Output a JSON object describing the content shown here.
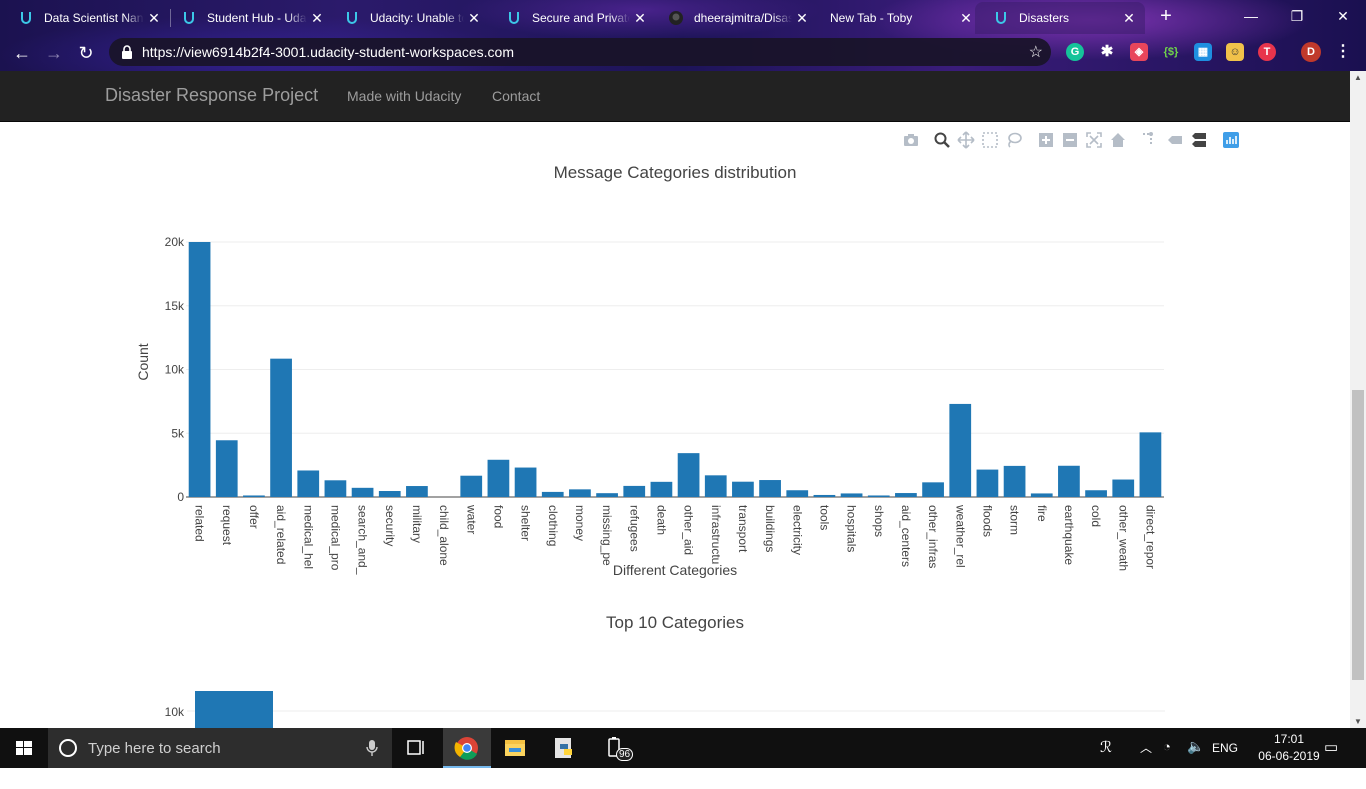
{
  "browser": {
    "tabs": [
      {
        "title": "Data Scientist Nanodegree",
        "icon": "udacity-icon"
      },
      {
        "title": "Student Hub - Udacity",
        "icon": "udacity-icon"
      },
      {
        "title": "Udacity: Unable to connect",
        "icon": "udacity-icon"
      },
      {
        "title": "Secure and Private",
        "icon": "udacity-icon"
      },
      {
        "title": "dheerajmitra/Disaster",
        "icon": "github-icon"
      },
      {
        "title": "New Tab - Toby",
        "icon": "none"
      },
      {
        "title": "Disasters",
        "icon": "udacity-icon"
      }
    ],
    "url": "https://view6914b2f4-3001.udacity-student-workspaces.com",
    "profile_initial": "D",
    "colors": {
      "accent": "#1f77b4",
      "navbar": "#222222"
    }
  },
  "navbar": {
    "brand": "Disaster Response Project",
    "links": [
      "Made with Udacity",
      "Contact"
    ]
  },
  "chart_data": [
    {
      "type": "bar",
      "title": "Message Categories distribution",
      "xlabel": "Different Categories",
      "ylabel": "Count",
      "ylim": [
        0,
        20000
      ],
      "yticks": [
        "0",
        "5k",
        "10k",
        "15k",
        "20k"
      ],
      "grid": true,
      "categories": [
        "related",
        "request",
        "offer",
        "aid_related",
        "medical_help",
        "medical_products",
        "search_and_rescue",
        "security",
        "military",
        "child_alone",
        "water",
        "food",
        "shelter",
        "clothing",
        "money",
        "missing_people",
        "refugees",
        "death",
        "other_aid",
        "infrastructure_related",
        "transport",
        "buildings",
        "electricity",
        "tools",
        "hospitals",
        "shops",
        "aid_centers",
        "other_infrastructure",
        "weather_related",
        "floods",
        "storm",
        "fire",
        "earthquake",
        "cold",
        "other_weather",
        "direct_report"
      ],
      "tick_labels": [
        "related",
        "request",
        "offer",
        "aid_related",
        "medical_hel",
        "medical_pro",
        "search_and_",
        "security",
        "military",
        "child_alone",
        "water",
        "food",
        "shelter",
        "clothing",
        "money",
        "missing_pe",
        "refugees",
        "death",
        "other_aid",
        "infrastructu",
        "transport",
        "buildings",
        "electricity",
        "tools",
        "hospitals",
        "shops",
        "aid_centers",
        "other_infras",
        "weather_rel",
        "floods",
        "storm",
        "fire",
        "earthquake",
        "cold",
        "other_weath",
        "direct_repor"
      ],
      "values": [
        20000,
        4450,
        120,
        10850,
        2080,
        1310,
        720,
        470,
        860,
        0,
        1670,
        2920,
        2310,
        400,
        600,
        300,
        870,
        1190,
        3440,
        1700,
        1200,
        1330,
        530,
        160,
        280,
        120,
        310,
        1150,
        7300,
        2150,
        2440,
        280,
        2450,
        530,
        1370,
        5070
      ]
    },
    {
      "type": "bar",
      "title": "Top 10 Categories",
      "ylabel": "",
      "yticks": [
        "10k"
      ],
      "values": [
        11000
      ]
    }
  ],
  "taskbar": {
    "search_placeholder": "Type here to search",
    "apps": [
      "task-view-icon",
      "chrome-icon",
      "file-explorer-icon",
      "python-icon",
      "battery-app-icon"
    ],
    "badge": "96",
    "lang": "ENG",
    "time": "17:01",
    "date": "06-06-2019"
  }
}
